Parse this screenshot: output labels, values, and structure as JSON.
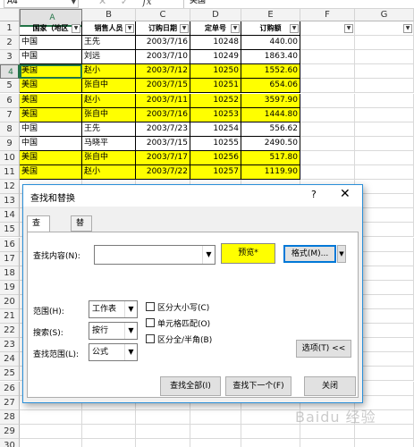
{
  "formula_bar": {
    "cell_ref": "A4",
    "cancel_icon": "✕",
    "enter_icon": "✓",
    "fx_label": "fx",
    "value": "美国"
  },
  "columns": [
    "A",
    "B",
    "C",
    "D",
    "E",
    "F",
    "G"
  ],
  "rows": [
    "1",
    "2",
    "3",
    "4",
    "5",
    "6",
    "7",
    "8",
    "9",
    "10",
    "11",
    "12",
    "13",
    "14",
    "15",
    "16",
    "17",
    "18",
    "19",
    "20",
    "21",
    "22",
    "23",
    "24",
    "25",
    "26",
    "27",
    "28",
    "29",
    "30"
  ],
  "table": {
    "headers": [
      "国家（地区",
      "销售人员",
      "订购日期",
      "定单号",
      "订购额"
    ],
    "rows": [
      [
        "中国",
        "王先",
        "2003/7/16",
        "10248",
        "440.00"
      ],
      [
        "中国",
        "刘远",
        "2003/7/10",
        "10249",
        "1863.40"
      ],
      [
        "美国",
        "赵小",
        "2003/7/12",
        "10250",
        "1552.60"
      ],
      [
        "美国",
        "张自中",
        "2003/7/15",
        "10251",
        "654.06"
      ],
      [
        "美国",
        "赵小",
        "2003/7/11",
        "10252",
        "3597.90"
      ],
      [
        "美国",
        "张自中",
        "2003/7/16",
        "10253",
        "1444.80"
      ],
      [
        "中国",
        "王先",
        "2003/7/23",
        "10254",
        "556.62"
      ],
      [
        "中国",
        "马晓平",
        "2003/7/15",
        "10255",
        "2490.50"
      ],
      [
        "美国",
        "张自中",
        "2003/7/17",
        "10256",
        "517.80"
      ],
      [
        "美国",
        "赵小",
        "2003/7/22",
        "10257",
        "1119.90"
      ]
    ],
    "highlight_color": "#ffff00"
  },
  "dialog": {
    "title": "查找和替换",
    "help": "?",
    "close": "✕",
    "tabs": [
      "查找(D)",
      "替换(P)"
    ],
    "find_label": "查找内容(N):",
    "find_value": "",
    "preview": "预览*",
    "format_button": "格式(M)...",
    "within_label": "范围(H):",
    "within_value": "工作表",
    "search_label": "搜索(S):",
    "search_value": "按行",
    "lookin_label": "查找范围(L):",
    "lookin_value": "公式",
    "match_case": "区分大小写(C)",
    "match_entire": "单元格匹配(O)",
    "match_width": "区分全/半角(B)",
    "options_button": "选项(T) <<",
    "find_all": "查找全部(I)",
    "find_next": "查找下一个(F)",
    "close_button": "关闭"
  },
  "watermark": "Baidu 经验"
}
